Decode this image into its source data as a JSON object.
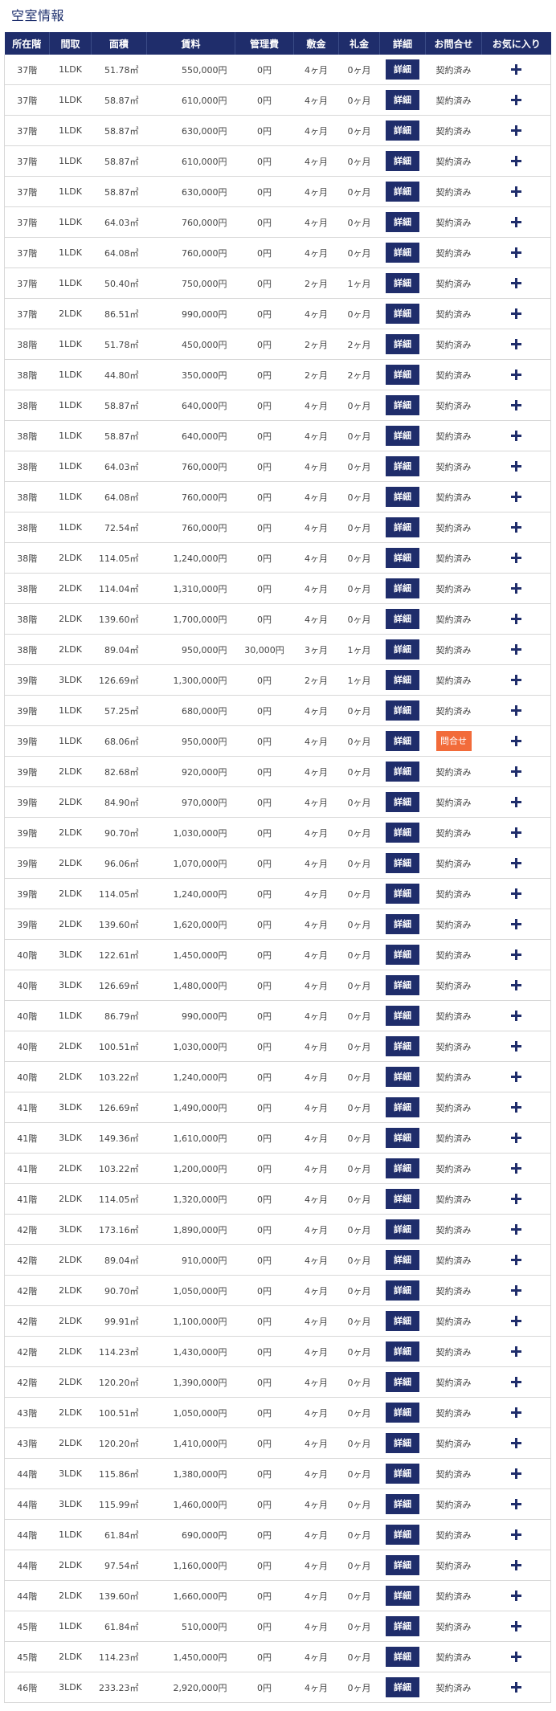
{
  "section_title": "空室情報",
  "headers": [
    "所在階",
    "間取",
    "面積",
    "賃料",
    "管理費",
    "敷金",
    "礼金",
    "詳細",
    "お問合せ",
    "お気に入り"
  ],
  "detail_label": "詳細",
  "contact_label": "問合せ",
  "contracted_label": "契約済み",
  "colors": {
    "header_bg": "#1f2d6b",
    "detail_button": "#1f2d6b",
    "contact_button": "#f26b3a",
    "title": "#1a2c6b",
    "row_border": "#d8d8d8"
  },
  "rows": [
    {
      "floor": "37階",
      "layout": "1LDK",
      "area": "51.78㎡",
      "rent": "550,000円",
      "fee": "0円",
      "deposit": "4ヶ月",
      "key_money": "0ヶ月",
      "status": "contracted"
    },
    {
      "floor": "37階",
      "layout": "1LDK",
      "area": "58.87㎡",
      "rent": "610,000円",
      "fee": "0円",
      "deposit": "4ヶ月",
      "key_money": "0ヶ月",
      "status": "contracted"
    },
    {
      "floor": "37階",
      "layout": "1LDK",
      "area": "58.87㎡",
      "rent": "630,000円",
      "fee": "0円",
      "deposit": "4ヶ月",
      "key_money": "0ヶ月",
      "status": "contracted"
    },
    {
      "floor": "37階",
      "layout": "1LDK",
      "area": "58.87㎡",
      "rent": "610,000円",
      "fee": "0円",
      "deposit": "4ヶ月",
      "key_money": "0ヶ月",
      "status": "contracted"
    },
    {
      "floor": "37階",
      "layout": "1LDK",
      "area": "58.87㎡",
      "rent": "630,000円",
      "fee": "0円",
      "deposit": "4ヶ月",
      "key_money": "0ヶ月",
      "status": "contracted"
    },
    {
      "floor": "37階",
      "layout": "1LDK",
      "area": "64.03㎡",
      "rent": "760,000円",
      "fee": "0円",
      "deposit": "4ヶ月",
      "key_money": "0ヶ月",
      "status": "contracted"
    },
    {
      "floor": "37階",
      "layout": "1LDK",
      "area": "64.08㎡",
      "rent": "760,000円",
      "fee": "0円",
      "deposit": "4ヶ月",
      "key_money": "0ヶ月",
      "status": "contracted"
    },
    {
      "floor": "37階",
      "layout": "1LDK",
      "area": "50.40㎡",
      "rent": "750,000円",
      "fee": "0円",
      "deposit": "2ヶ月",
      "key_money": "1ヶ月",
      "status": "contracted"
    },
    {
      "floor": "37階",
      "layout": "2LDK",
      "area": "86.51㎡",
      "rent": "990,000円",
      "fee": "0円",
      "deposit": "4ヶ月",
      "key_money": "0ヶ月",
      "status": "contracted"
    },
    {
      "floor": "38階",
      "layout": "1LDK",
      "area": "51.78㎡",
      "rent": "450,000円",
      "fee": "0円",
      "deposit": "2ヶ月",
      "key_money": "2ヶ月",
      "status": "contracted"
    },
    {
      "floor": "38階",
      "layout": "1LDK",
      "area": "44.80㎡",
      "rent": "350,000円",
      "fee": "0円",
      "deposit": "2ヶ月",
      "key_money": "2ヶ月",
      "status": "contracted"
    },
    {
      "floor": "38階",
      "layout": "1LDK",
      "area": "58.87㎡",
      "rent": "640,000円",
      "fee": "0円",
      "deposit": "4ヶ月",
      "key_money": "0ヶ月",
      "status": "contracted"
    },
    {
      "floor": "38階",
      "layout": "1LDK",
      "area": "58.87㎡",
      "rent": "640,000円",
      "fee": "0円",
      "deposit": "4ヶ月",
      "key_money": "0ヶ月",
      "status": "contracted"
    },
    {
      "floor": "38階",
      "layout": "1LDK",
      "area": "64.03㎡",
      "rent": "760,000円",
      "fee": "0円",
      "deposit": "4ヶ月",
      "key_money": "0ヶ月",
      "status": "contracted"
    },
    {
      "floor": "38階",
      "layout": "1LDK",
      "area": "64.08㎡",
      "rent": "760,000円",
      "fee": "0円",
      "deposit": "4ヶ月",
      "key_money": "0ヶ月",
      "status": "contracted"
    },
    {
      "floor": "38階",
      "layout": "1LDK",
      "area": "72.54㎡",
      "rent": "760,000円",
      "fee": "0円",
      "deposit": "4ヶ月",
      "key_money": "0ヶ月",
      "status": "contracted"
    },
    {
      "floor": "38階",
      "layout": "2LDK",
      "area": "114.05㎡",
      "rent": "1,240,000円",
      "fee": "0円",
      "deposit": "4ヶ月",
      "key_money": "0ヶ月",
      "status": "contracted"
    },
    {
      "floor": "38階",
      "layout": "2LDK",
      "area": "114.04㎡",
      "rent": "1,310,000円",
      "fee": "0円",
      "deposit": "4ヶ月",
      "key_money": "0ヶ月",
      "status": "contracted"
    },
    {
      "floor": "38階",
      "layout": "2LDK",
      "area": "139.60㎡",
      "rent": "1,700,000円",
      "fee": "0円",
      "deposit": "4ヶ月",
      "key_money": "0ヶ月",
      "status": "contracted"
    },
    {
      "floor": "38階",
      "layout": "2LDK",
      "area": "89.04㎡",
      "rent": "950,000円",
      "fee": "30,000円",
      "deposit": "3ヶ月",
      "key_money": "1ヶ月",
      "status": "contracted"
    },
    {
      "floor": "39階",
      "layout": "3LDK",
      "area": "126.69㎡",
      "rent": "1,300,000円",
      "fee": "0円",
      "deposit": "2ヶ月",
      "key_money": "1ヶ月",
      "status": "contracted"
    },
    {
      "floor": "39階",
      "layout": "1LDK",
      "area": "57.25㎡",
      "rent": "680,000円",
      "fee": "0円",
      "deposit": "4ヶ月",
      "key_money": "0ヶ月",
      "status": "contracted"
    },
    {
      "floor": "39階",
      "layout": "1LDK",
      "area": "68.06㎡",
      "rent": "950,000円",
      "fee": "0円",
      "deposit": "4ヶ月",
      "key_money": "0ヶ月",
      "status": "inquiry"
    },
    {
      "floor": "39階",
      "layout": "2LDK",
      "area": "82.68㎡",
      "rent": "920,000円",
      "fee": "0円",
      "deposit": "4ヶ月",
      "key_money": "0ヶ月",
      "status": "contracted"
    },
    {
      "floor": "39階",
      "layout": "2LDK",
      "area": "84.90㎡",
      "rent": "970,000円",
      "fee": "0円",
      "deposit": "4ヶ月",
      "key_money": "0ヶ月",
      "status": "contracted"
    },
    {
      "floor": "39階",
      "layout": "2LDK",
      "area": "90.70㎡",
      "rent": "1,030,000円",
      "fee": "0円",
      "deposit": "4ヶ月",
      "key_money": "0ヶ月",
      "status": "contracted"
    },
    {
      "floor": "39階",
      "layout": "2LDK",
      "area": "96.06㎡",
      "rent": "1,070,000円",
      "fee": "0円",
      "deposit": "4ヶ月",
      "key_money": "0ヶ月",
      "status": "contracted"
    },
    {
      "floor": "39階",
      "layout": "2LDK",
      "area": "114.05㎡",
      "rent": "1,240,000円",
      "fee": "0円",
      "deposit": "4ヶ月",
      "key_money": "0ヶ月",
      "status": "contracted"
    },
    {
      "floor": "39階",
      "layout": "2LDK",
      "area": "139.60㎡",
      "rent": "1,620,000円",
      "fee": "0円",
      "deposit": "4ヶ月",
      "key_money": "0ヶ月",
      "status": "contracted"
    },
    {
      "floor": "40階",
      "layout": "3LDK",
      "area": "122.61㎡",
      "rent": "1,450,000円",
      "fee": "0円",
      "deposit": "4ヶ月",
      "key_money": "0ヶ月",
      "status": "contracted"
    },
    {
      "floor": "40階",
      "layout": "3LDK",
      "area": "126.69㎡",
      "rent": "1,480,000円",
      "fee": "0円",
      "deposit": "4ヶ月",
      "key_money": "0ヶ月",
      "status": "contracted"
    },
    {
      "floor": "40階",
      "layout": "1LDK",
      "area": "86.79㎡",
      "rent": "990,000円",
      "fee": "0円",
      "deposit": "4ヶ月",
      "key_money": "0ヶ月",
      "status": "contracted"
    },
    {
      "floor": "40階",
      "layout": "2LDK",
      "area": "100.51㎡",
      "rent": "1,030,000円",
      "fee": "0円",
      "deposit": "4ヶ月",
      "key_money": "0ヶ月",
      "status": "contracted"
    },
    {
      "floor": "40階",
      "layout": "2LDK",
      "area": "103.22㎡",
      "rent": "1,240,000円",
      "fee": "0円",
      "deposit": "4ヶ月",
      "key_money": "0ヶ月",
      "status": "contracted"
    },
    {
      "floor": "41階",
      "layout": "3LDK",
      "area": "126.69㎡",
      "rent": "1,490,000円",
      "fee": "0円",
      "deposit": "4ヶ月",
      "key_money": "0ヶ月",
      "status": "contracted"
    },
    {
      "floor": "41階",
      "layout": "3LDK",
      "area": "149.36㎡",
      "rent": "1,610,000円",
      "fee": "0円",
      "deposit": "4ヶ月",
      "key_money": "0ヶ月",
      "status": "contracted"
    },
    {
      "floor": "41階",
      "layout": "2LDK",
      "area": "103.22㎡",
      "rent": "1,200,000円",
      "fee": "0円",
      "deposit": "4ヶ月",
      "key_money": "0ヶ月",
      "status": "contracted"
    },
    {
      "floor": "41階",
      "layout": "2LDK",
      "area": "114.05㎡",
      "rent": "1,320,000円",
      "fee": "0円",
      "deposit": "4ヶ月",
      "key_money": "0ヶ月",
      "status": "contracted"
    },
    {
      "floor": "42階",
      "layout": "3LDK",
      "area": "173.16㎡",
      "rent": "1,890,000円",
      "fee": "0円",
      "deposit": "4ヶ月",
      "key_money": "0ヶ月",
      "status": "contracted"
    },
    {
      "floor": "42階",
      "layout": "2LDK",
      "area": "89.04㎡",
      "rent": "910,000円",
      "fee": "0円",
      "deposit": "4ヶ月",
      "key_money": "0ヶ月",
      "status": "contracted"
    },
    {
      "floor": "42階",
      "layout": "2LDK",
      "area": "90.70㎡",
      "rent": "1,050,000円",
      "fee": "0円",
      "deposit": "4ヶ月",
      "key_money": "0ヶ月",
      "status": "contracted"
    },
    {
      "floor": "42階",
      "layout": "2LDK",
      "area": "99.91㎡",
      "rent": "1,100,000円",
      "fee": "0円",
      "deposit": "4ヶ月",
      "key_money": "0ヶ月",
      "status": "contracted"
    },
    {
      "floor": "42階",
      "layout": "2LDK",
      "area": "114.23㎡",
      "rent": "1,430,000円",
      "fee": "0円",
      "deposit": "4ヶ月",
      "key_money": "0ヶ月",
      "status": "contracted"
    },
    {
      "floor": "42階",
      "layout": "2LDK",
      "area": "120.20㎡",
      "rent": "1,390,000円",
      "fee": "0円",
      "deposit": "4ヶ月",
      "key_money": "0ヶ月",
      "status": "contracted"
    },
    {
      "floor": "43階",
      "layout": "2LDK",
      "area": "100.51㎡",
      "rent": "1,050,000円",
      "fee": "0円",
      "deposit": "4ヶ月",
      "key_money": "0ヶ月",
      "status": "contracted"
    },
    {
      "floor": "43階",
      "layout": "2LDK",
      "area": "120.20㎡",
      "rent": "1,410,000円",
      "fee": "0円",
      "deposit": "4ヶ月",
      "key_money": "0ヶ月",
      "status": "contracted"
    },
    {
      "floor": "44階",
      "layout": "3LDK",
      "area": "115.86㎡",
      "rent": "1,380,000円",
      "fee": "0円",
      "deposit": "4ヶ月",
      "key_money": "0ヶ月",
      "status": "contracted"
    },
    {
      "floor": "44階",
      "layout": "3LDK",
      "area": "115.99㎡",
      "rent": "1,460,000円",
      "fee": "0円",
      "deposit": "4ヶ月",
      "key_money": "0ヶ月",
      "status": "contracted"
    },
    {
      "floor": "44階",
      "layout": "1LDK",
      "area": "61.84㎡",
      "rent": "690,000円",
      "fee": "0円",
      "deposit": "4ヶ月",
      "key_money": "0ヶ月",
      "status": "contracted"
    },
    {
      "floor": "44階",
      "layout": "2LDK",
      "area": "97.54㎡",
      "rent": "1,160,000円",
      "fee": "0円",
      "deposit": "4ヶ月",
      "key_money": "0ヶ月",
      "status": "contracted"
    },
    {
      "floor": "44階",
      "layout": "2LDK",
      "area": "139.60㎡",
      "rent": "1,660,000円",
      "fee": "0円",
      "deposit": "4ヶ月",
      "key_money": "0ヶ月",
      "status": "contracted"
    },
    {
      "floor": "45階",
      "layout": "1LDK",
      "area": "61.84㎡",
      "rent": "510,000円",
      "fee": "0円",
      "deposit": "4ヶ月",
      "key_money": "0ヶ月",
      "status": "contracted"
    },
    {
      "floor": "45階",
      "layout": "2LDK",
      "area": "114.23㎡",
      "rent": "1,450,000円",
      "fee": "0円",
      "deposit": "4ヶ月",
      "key_money": "0ヶ月",
      "status": "contracted"
    },
    {
      "floor": "46階",
      "layout": "3LDK",
      "area": "233.23㎡",
      "rent": "2,920,000円",
      "fee": "0円",
      "deposit": "4ヶ月",
      "key_money": "0ヶ月",
      "status": "contracted"
    }
  ]
}
